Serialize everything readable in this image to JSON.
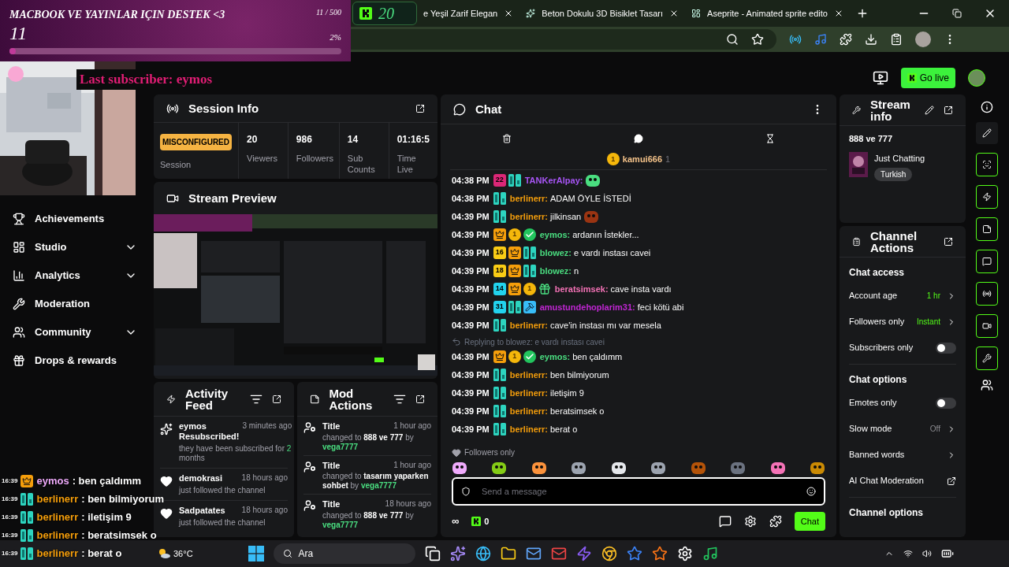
{
  "goal_overlay": {
    "title": "MACBOOK VE YAYINLAR IÇIN DESTEK <3",
    "count": "11",
    "progress": "11 / 500",
    "percent": "2%",
    "level": 0.02
  },
  "viewer_pill": {
    "count": "20"
  },
  "browser": {
    "tabs": [
      {
        "label": "e Yeşil Zarif Elegan",
        "selected": false
      },
      {
        "label": "Beton Dokulu 3D Bisiklet Tasarı",
        "selected": false
      },
      {
        "label": "Aseprite - Animated sprite edito",
        "selected": false
      }
    ]
  },
  "header": {
    "last_subscriber": "Last subscriber: eymos",
    "go_live": "Go live"
  },
  "sidebar": {
    "items": [
      {
        "label": "Achievements",
        "kind": "link"
      },
      {
        "label": "Studio",
        "kind": "group"
      },
      {
        "label": "Analytics",
        "kind": "group"
      },
      {
        "label": "Moderation",
        "kind": "link"
      },
      {
        "label": "Community",
        "kind": "group"
      },
      {
        "label": "Drops & rewards",
        "kind": "link"
      }
    ]
  },
  "session_info": {
    "title": "Session Info",
    "status": "MISCONFIGURED",
    "status_label": "Session",
    "stats": [
      {
        "value": "20",
        "label": "Viewers"
      },
      {
        "value": "986",
        "label": "Followers"
      },
      {
        "value": "14",
        "label": "Sub Counts"
      },
      {
        "value": "01:16:5",
        "label": "Time Live"
      }
    ]
  },
  "stream_preview": {
    "title": "Stream Preview"
  },
  "activity_feed": {
    "title": "Activity Feed",
    "items": [
      {
        "kind": "resub",
        "user": "eymos Resubscribed!",
        "time": "3 minutes ago",
        "detail": "they have been subscribed for",
        "highlight": "2",
        "detail_end": "months"
      },
      {
        "kind": "follow",
        "user": "demokrasi",
        "time": "18 hours ago",
        "detail": "just followed the channel"
      },
      {
        "kind": "follow",
        "user": "Sadpatates",
        "time": "18 hours ago",
        "detail": "just followed the channel"
      }
    ]
  },
  "mod_actions": {
    "title": "Mod Actions",
    "items": [
      {
        "title": "Title",
        "time": "1 hour ago",
        "prefix": "changed to",
        "value": "888 ve 777",
        "by": "by",
        "mod": "vega7777"
      },
      {
        "title": "Title",
        "time": "1 hour ago",
        "prefix": "changed to",
        "value": "tasarım yaparken sohbet",
        "by": "by",
        "mod": "vega7777"
      },
      {
        "title": "Title",
        "time": "18 hours ago",
        "prefix": "changed to",
        "value": "888 ve 777",
        "by": "by",
        "mod": "vega7777"
      }
    ]
  },
  "chat": {
    "title": "Chat",
    "pinned": {
      "coin": "1",
      "user": "kamui666",
      "count": "1"
    },
    "messages": [
      {
        "time": "04:38 PM",
        "badges": [
          {
            "kind": "sub",
            "text": "22",
            "color": "#db2777"
          },
          {
            "kind": "og"
          }
        ],
        "user": "TANKerAlpay:",
        "color": "#a855f7",
        "emote": true
      },
      {
        "time": "04:38 PM",
        "badges": [
          {
            "kind": "og"
          }
        ],
        "user": "berlinerr:",
        "color": "#f59e0b",
        "text": "ADAM ÖYLE İSTEDİ"
      },
      {
        "time": "04:39 PM",
        "badges": [
          {
            "kind": "og"
          }
        ],
        "user": "berlinerr:",
        "color": "#f59e0b",
        "text": "jilkinsan",
        "emote": true
      },
      {
        "time": "04:39 PM",
        "badges": [
          {
            "kind": "crown"
          },
          {
            "kind": "coin",
            "text": "1"
          },
          {
            "kind": "verified"
          }
        ],
        "user": "eymos:",
        "color": "#4ade80",
        "text": "ardanın İstekler..."
      },
      {
        "time": "04:39 PM",
        "badges": [
          {
            "kind": "sub",
            "text": "16",
            "color": "#facc15"
          },
          {
            "kind": "crown"
          },
          {
            "kind": "og"
          }
        ],
        "user": "blowez:",
        "color": "#4ade80",
        "text": "e vardı instası cavei"
      },
      {
        "time": "04:39 PM",
        "badges": [
          {
            "kind": "sub",
            "text": "18",
            "color": "#facc15"
          },
          {
            "kind": "crown"
          },
          {
            "kind": "og"
          }
        ],
        "user": "blowez:",
        "color": "#4ade80",
        "text": "n"
      },
      {
        "time": "04:39 PM",
        "badges": [
          {
            "kind": "sub",
            "text": "14",
            "color": "#22d3ee"
          },
          {
            "kind": "crown"
          },
          {
            "kind": "coin",
            "text": "1"
          },
          {
            "kind": "gift"
          }
        ],
        "user": "beratsimsek:",
        "color": "#f472b6",
        "text": "cave insta vardı"
      },
      {
        "time": "04:39 PM",
        "badges": [
          {
            "kind": "sub",
            "text": "31",
            "color": "#22d3ee"
          },
          {
            "kind": "og"
          },
          {
            "kind": "mod"
          }
        ],
        "user": "amustundehoplarim31:",
        "color": "#c026d3",
        "text": "feci kötü abi"
      },
      {
        "time": "04:39 PM",
        "badges": [
          {
            "kind": "og"
          }
        ],
        "user": "berlinerr:",
        "color": "#f59e0b",
        "text": "cave'in instası mı var mesela"
      },
      {
        "time": "04:39 PM",
        "reply": "Replying to blowez: e vardı instası cavei",
        "badges": [
          {
            "kind": "crown"
          },
          {
            "kind": "coin",
            "text": "1"
          },
          {
            "kind": "verified"
          }
        ],
        "user": "eymos:",
        "color": "#4ade80",
        "text": "ben çaldımm"
      },
      {
        "time": "04:39 PM",
        "badges": [
          {
            "kind": "og"
          }
        ],
        "user": "berlinerr:",
        "color": "#f59e0b",
        "text": "ben bilmiyorum"
      },
      {
        "time": "04:39 PM",
        "badges": [
          {
            "kind": "og"
          }
        ],
        "user": "berlinerr:",
        "color": "#f59e0b",
        "text": "iletişim 9"
      },
      {
        "time": "04:39 PM",
        "badges": [
          {
            "kind": "og"
          }
        ],
        "user": "berlinerr:",
        "color": "#f59e0b",
        "text": "beratsimsek o"
      },
      {
        "time": "04:39 PM",
        "badges": [
          {
            "kind": "og"
          }
        ],
        "user": "berlinerr:",
        "color": "#f59e0b",
        "text": "berat o"
      }
    ],
    "mode": "Followers only",
    "placeholder": "Send a message",
    "infinity": "∞",
    "points": "0",
    "send": "Chat"
  },
  "stream_info": {
    "title": "Stream info",
    "stream_title": "888 ve 777",
    "category": "Just Chatting",
    "tag": "Turkish"
  },
  "channel_actions": {
    "title": "Channel Actions",
    "sections": [
      {
        "heading": "Chat access",
        "rows": [
          {
            "kind": "link",
            "label": "Account age",
            "value": "1 hr",
            "enabled": true
          },
          {
            "kind": "link",
            "label": "Followers only",
            "value": "Instant",
            "enabled": true
          },
          {
            "kind": "toggle",
            "label": "Subscribers only",
            "on": false
          }
        ]
      },
      {
        "heading": "Chat options",
        "rows": [
          {
            "kind": "toggle",
            "label": "Emotes only",
            "on": false
          },
          {
            "kind": "link",
            "label": "Slow mode",
            "value": "Off",
            "enabled": false
          },
          {
            "kind": "link",
            "label": "Banned words"
          },
          {
            "kind": "external",
            "label": "AI Chat Moderation"
          }
        ]
      },
      {
        "heading": "Channel options"
      }
    ]
  },
  "overlay_chat": [
    {
      "time": "16:39",
      "kind": "crown",
      "user": "eymos",
      "color": "#f0abfc",
      "text": ": ben çaldımm"
    },
    {
      "time": "16:39",
      "kind": "og",
      "user": "berlinerr",
      "color": "#f59e0b",
      "text": ": ben bilmiyorum"
    },
    {
      "time": "16:39",
      "kind": "og",
      "user": "berlinerr",
      "color": "#f59e0b",
      "text": ": iletişim 9"
    },
    {
      "time": "16:39",
      "kind": "og",
      "user": "berlinerr",
      "color": "#f59e0b",
      "text": ": beratsimsek o"
    },
    {
      "time": "16:39",
      "kind": "og",
      "user": "berlinerr",
      "color": "#f59e0b",
      "text": ": berat o"
    }
  ],
  "taskbar": {
    "temperature": "36°C",
    "search": "Ara"
  }
}
